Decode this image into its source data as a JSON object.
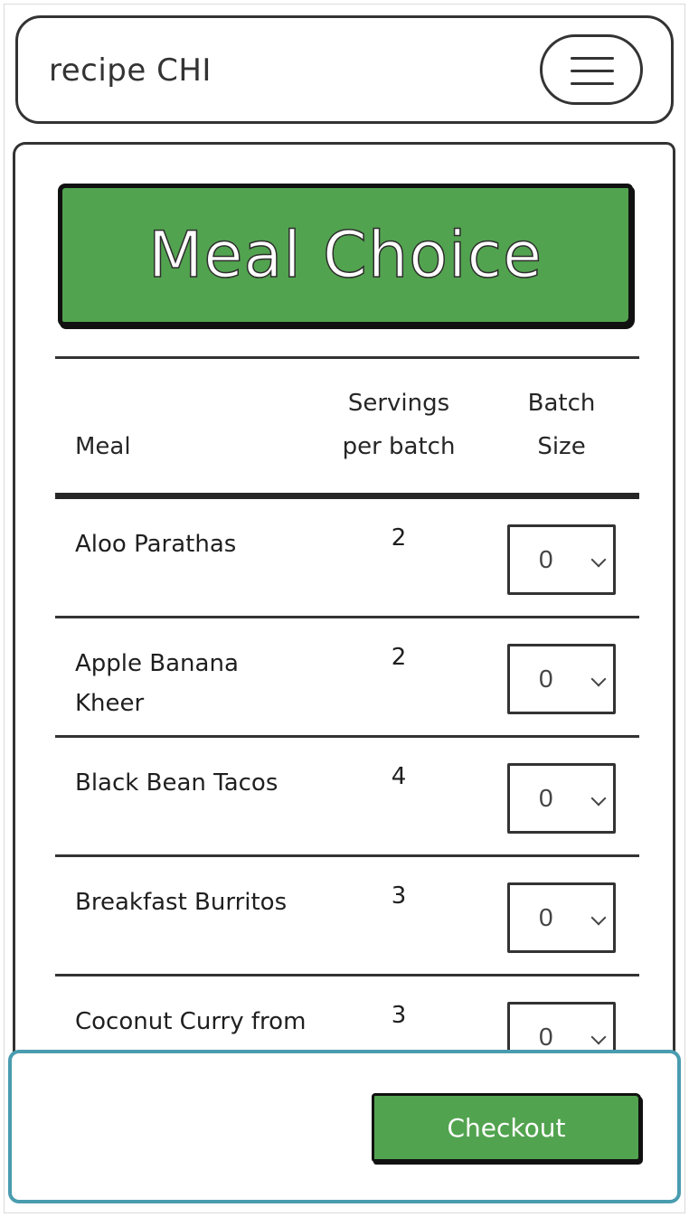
{
  "header": {
    "app_title": "recipe CHI",
    "menu_icon": "hamburger-menu-icon"
  },
  "main": {
    "banner_title": "Meal Choice",
    "table": {
      "columns": [
        "Meal",
        "Servings per batch",
        "Batch Size"
      ],
      "column_lines": {
        "servings": [
          "Servings",
          "per batch"
        ],
        "batch": [
          "Batch",
          "Size"
        ]
      },
      "rows": [
        {
          "meal": "Aloo Parathas",
          "servings": "2",
          "batch_size": "0"
        },
        {
          "meal": "Apple Banana Kheer",
          "servings": "2",
          "batch_size": "0"
        },
        {
          "meal": "Black Bean Tacos",
          "servings": "4",
          "batch_size": "0"
        },
        {
          "meal": "Breakfast Burritos",
          "servings": "3",
          "batch_size": "0"
        },
        {
          "meal": "Coconut Curry from",
          "servings": "3",
          "batch_size": "0"
        }
      ]
    }
  },
  "footer": {
    "checkout_label": "Checkout"
  },
  "colors": {
    "accent_green": "#52a34f",
    "footer_border": "#4a9caf",
    "ink": "#333333"
  }
}
